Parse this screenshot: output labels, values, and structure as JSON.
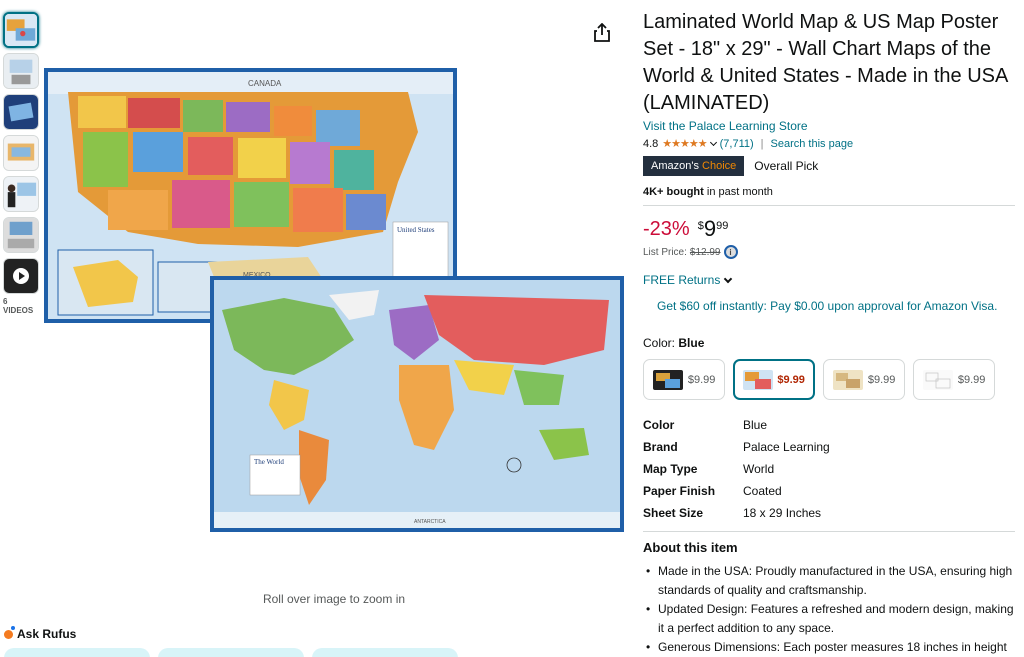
{
  "thumbnails": {
    "video_count_label": "6 VIDEOS"
  },
  "product": {
    "title": "Laminated World Map & US Map Poster Set - 18\" x 29\" - Wall Chart Maps of the World & United States - Made in the USA (LAMINATED)",
    "store_link": "Visit the Palace Learning Store",
    "rating": "4.8",
    "stars": "★★★★★",
    "rating_count": "(7,711)",
    "search_page": "Search this page",
    "choice_badge_prefix": "Amazon's",
    "choice_badge_accent": "Choice",
    "choice_text": "Overall Pick",
    "bought_bold": "4K+ bought",
    "bought_rest": "in past month"
  },
  "pricing": {
    "discount": "-23%",
    "currency": "$",
    "whole": "9",
    "fraction": "99",
    "list_price_label": "List Price:",
    "list_price": "$12.99",
    "free_returns": "FREE Returns",
    "visa_offer": "Get $60 off instantly: Pay $0.00 upon approval for Amazon Visa."
  },
  "color_selection": {
    "label": "Color:",
    "selected": "Blue",
    "swatches": [
      {
        "price": "$9.99"
      },
      {
        "price": "$9.99"
      },
      {
        "price": "$9.99"
      },
      {
        "price": "$9.99"
      }
    ]
  },
  "specs": [
    {
      "key": "Color",
      "value": "Blue"
    },
    {
      "key": "Brand",
      "value": "Palace Learning"
    },
    {
      "key": "Map Type",
      "value": "World"
    },
    {
      "key": "Paper Finish",
      "value": "Coated"
    },
    {
      "key": "Sheet Size",
      "value": "18 x 29 Inches"
    }
  ],
  "about": {
    "title": "About this item",
    "bullets": [
      "Made in the USA: Proudly manufactured in the USA, ensuring high standards of quality and craftsmanship.",
      "Updated Design: Features a refreshed and modern design, making it a perfect addition to any space.",
      "Generous Dimensions: Each poster measures 18 inches in height"
    ]
  },
  "image_area": {
    "rollover_text": "Roll over image to zoom in",
    "us_map_label_canada": "CANADA",
    "us_map_label_mexico": "MEXICO",
    "us_map_legend_title": "United States",
    "world_map_legend_title": "The World",
    "world_map_label_antarctica": "ANTARCTICA"
  },
  "rufus": {
    "label": "Ask Rufus"
  },
  "colors": {
    "link": "#007185",
    "discount": "#cc0c39",
    "star": "#de7921",
    "badge_bg": "#232f3e",
    "badge_accent": "#f08804",
    "map_border": "#1f5fa8"
  }
}
